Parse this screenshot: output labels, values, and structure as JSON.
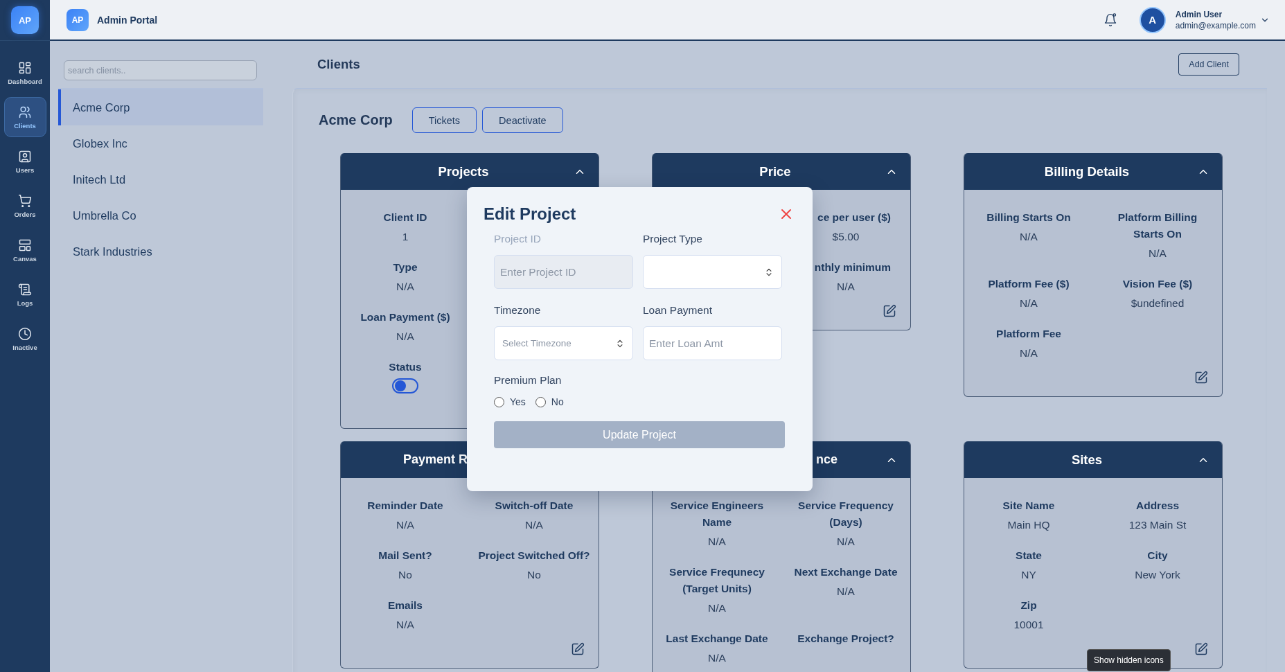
{
  "rail": {
    "logo": "AP",
    "items": [
      {
        "label": "Dashboard",
        "selected": false
      },
      {
        "label": "Clients",
        "selected": true
      },
      {
        "label": "Users",
        "selected": false
      },
      {
        "label": "Orders",
        "selected": false
      },
      {
        "label": "Canvas",
        "selected": false
      },
      {
        "label": "Logs",
        "selected": false
      },
      {
        "label": "Inactive",
        "selected": false
      }
    ]
  },
  "topbar": {
    "logo": "AP",
    "title": "Admin Portal",
    "user": {
      "avatar": "A",
      "name": "Admin User",
      "email": "admin@example.com"
    }
  },
  "client_list": {
    "search_placeholder": "search clients..",
    "items": [
      {
        "name": "Acme Corp",
        "selected": true
      },
      {
        "name": "Globex Inc",
        "selected": false
      },
      {
        "name": "Initech Ltd",
        "selected": false
      },
      {
        "name": "Umbrella Co",
        "selected": false
      },
      {
        "name": "Stark Industries",
        "selected": false
      }
    ]
  },
  "main": {
    "title": "Clients",
    "add_button": "Add Client",
    "client_name": "Acme Corp",
    "actions": [
      "Tickets",
      "Deactivate"
    ],
    "cards": [
      {
        "title": "Projects",
        "fields": [
          {
            "kind": "text",
            "label": "Client ID",
            "value": "1"
          },
          {
            "kind": "text",
            "label": "Type",
            "value": "N/A"
          },
          {
            "kind": "text",
            "label": "Loan Payment ($)",
            "value": "N/A"
          },
          {
            "kind": "toggle",
            "label": "Status",
            "on": false
          }
        ]
      },
      {
        "title": "Price",
        "fields": [
          {
            "kind": "text",
            "label": "ce per user ($)",
            "value": "$5.00"
          },
          {
            "kind": "text",
            "label": "nthly minimum",
            "value": "N/A"
          }
        ]
      },
      {
        "title": "Billing Details",
        "fields": [
          {
            "kind": "text",
            "label": "Billing Starts On",
            "value": "N/A"
          },
          {
            "kind": "text",
            "label": "Platform Billing Starts On",
            "value": "N/A"
          },
          {
            "kind": "text",
            "label": "Platform Fee ($)",
            "value": "N/A"
          },
          {
            "kind": "text",
            "label": "Vision Fee ($)",
            "value": "$undefined"
          },
          {
            "kind": "text",
            "label": "Platform Fee",
            "value": "N/A"
          }
        ]
      },
      {
        "title": "Payment R",
        "fields": [
          {
            "kind": "text",
            "label": "Reminder Date",
            "value": "N/A"
          },
          {
            "kind": "text",
            "label": "Switch-off Date",
            "value": "N/A"
          },
          {
            "kind": "text",
            "label": "Mail Sent?",
            "value": "No"
          },
          {
            "kind": "text",
            "label": "Project Switched Off?",
            "value": "No"
          },
          {
            "kind": "text",
            "label": "Emails",
            "value": "N/A"
          }
        ]
      },
      {
        "title": "nce",
        "fields": [
          {
            "kind": "text",
            "label": "Service Engineers Name",
            "value": "N/A"
          },
          {
            "kind": "text",
            "label": "Service Frequency (Days)",
            "value": "N/A"
          },
          {
            "kind": "text",
            "label": "Service Frequnecy (Target Units)",
            "value": "N/A"
          },
          {
            "kind": "text",
            "label": "Next Exchange Date",
            "value": "N/A"
          },
          {
            "kind": "text",
            "label": "Last Exchange Date",
            "value": "N/A"
          },
          {
            "kind": "text",
            "label": "Exchange Project?"
          }
        ]
      },
      {
        "title": "Sites",
        "fields": [
          {
            "kind": "text",
            "label": "Site Name",
            "value": "Main HQ"
          },
          {
            "kind": "text",
            "label": "Address",
            "value": "123 Main St"
          },
          {
            "kind": "text",
            "label": "State",
            "value": "NY"
          },
          {
            "kind": "text",
            "label": "City",
            "value": "New York"
          },
          {
            "kind": "text",
            "label": "Zip",
            "value": "10001"
          }
        ]
      }
    ]
  },
  "modal": {
    "title": "Edit Project",
    "fields": [
      {
        "kind": "input",
        "label": "Project ID",
        "placeholder": "Enter Project ID",
        "disabled": true
      },
      {
        "kind": "select",
        "label": "Project Type",
        "disabled": false
      },
      {
        "kind": "select",
        "label": "Timezone",
        "placeholder": "Select Timezone",
        "disabled": false
      },
      {
        "kind": "input",
        "label": "Loan Payment",
        "placeholder": "Enter Loan Amt",
        "disabled": false
      }
    ],
    "premium_plan": {
      "label": "Premium Plan",
      "options": [
        {
          "label": "Yes",
          "selected": false
        },
        {
          "label": "No",
          "selected": false
        }
      ]
    },
    "submit": {
      "label": "Update Project",
      "disabled": true
    }
  },
  "tooltip": "Show hidden icons"
}
